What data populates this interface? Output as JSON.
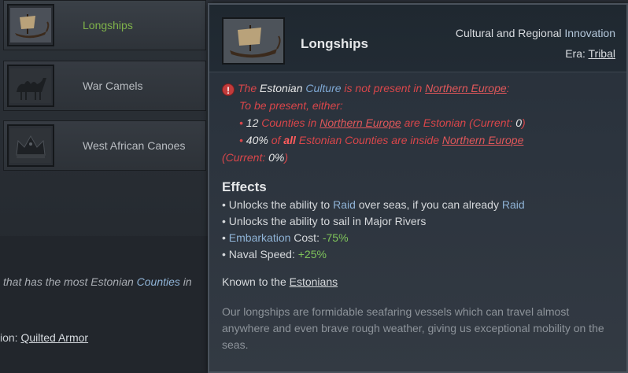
{
  "sidebar": {
    "items": [
      {
        "label": "Longships",
        "icon": "longship-icon",
        "active": true
      },
      {
        "label": "War Camels",
        "icon": "camel-icon",
        "active": false
      },
      {
        "label": "West African Canoes",
        "icon": "crown-icon",
        "active": false
      }
    ],
    "bg_line1_pre": "that has the most Estonian ",
    "bg_line1_hl": "Counties",
    "bg_line1_post": " in",
    "bg_line2_pre": "ion: ",
    "bg_line2_link": "Quilted Armor"
  },
  "tooltip": {
    "title": "Longships",
    "kind_pre": "Cultural and Regional ",
    "kind_hl": "Innovation",
    "era_label": "Era: ",
    "era_value": "Tribal",
    "req": {
      "l1_the": "The ",
      "l1_culture_name": "Estonian",
      "l1_culture": "Culture",
      "l1_mid": " is not present in ",
      "l1_region": "Northern Europe",
      "l1_end": ":",
      "l2": "To be present, either:",
      "l3_a": "• ",
      "l3_num": "12",
      "l3_b": " Counties in ",
      "l3_region": "Northern Europe",
      "l3_c": " are Estonian (Current: ",
      "l3_cur": "0",
      "l3_d": ")",
      "l4_a": "• ",
      "l4_num": "40%",
      "l4_b": " of ",
      "l4_all": "all",
      "l4_c": " Estonian Counties are inside ",
      "l4_region": "Northern Europe",
      "l5_a": "(Current: ",
      "l5_cur": "0%",
      "l5_b": ")"
    },
    "effects_title": "Effects",
    "effects": {
      "e1_a": "• Unlocks the ability to ",
      "e1_raid": "Raid",
      "e1_b": " over seas, if you can already ",
      "e1_raid2": "Raid",
      "e2": "• Unlocks the ability to sail in Major Rivers",
      "e3_a": "• ",
      "e3_hl": "Embarkation",
      "e3_b": " Cost: ",
      "e3_val": "-75%",
      "e4_a": "• Naval Speed: ",
      "e4_val": "+25%"
    },
    "known_pre": "Known to the ",
    "known_link": "Estonians",
    "flavor": "Our longships are formidable seafaring vessels which can travel almost anywhere and even brave rough weather, giving us exceptional mobility on the seas."
  },
  "colors": {
    "accent_green": "#7fb24a",
    "warning_red": "#d9464a",
    "highlight_blue": "#8fb3d6",
    "positive_green": "#7fc45a"
  }
}
